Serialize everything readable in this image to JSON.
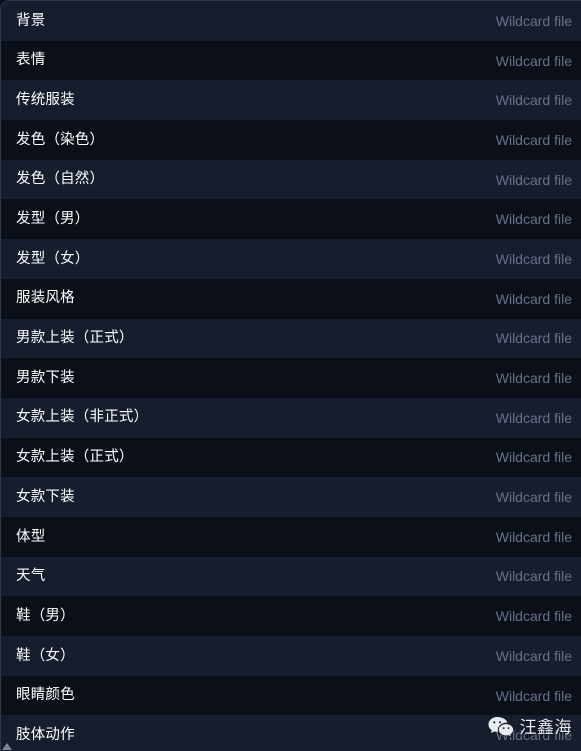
{
  "panel": {
    "accent_border": "#2b3850",
    "row_bg_odd": "#161d2c",
    "row_bg_even": "#0b1018",
    "label_color": "#ffffff",
    "type_color": "#67718a",
    "rows": [
      {
        "label": "背景",
        "type": "Wildcard file"
      },
      {
        "label": "表情",
        "type": "Wildcard file"
      },
      {
        "label": "传统服装",
        "type": "Wildcard file"
      },
      {
        "label": "发色（染色）",
        "type": "Wildcard file"
      },
      {
        "label": "发色（自然）",
        "type": "Wildcard file"
      },
      {
        "label": "发型（男）",
        "type": "Wildcard file"
      },
      {
        "label": "发型（女）",
        "type": "Wildcard file"
      },
      {
        "label": "服装风格",
        "type": "Wildcard file"
      },
      {
        "label": "男款上装（正式）",
        "type": "Wildcard file"
      },
      {
        "label": "男款下装",
        "type": "Wildcard file"
      },
      {
        "label": "女款上装（非正式）",
        "type": "Wildcard file"
      },
      {
        "label": "女款上装（正式）",
        "type": "Wildcard file"
      },
      {
        "label": "女款下装",
        "type": "Wildcard file"
      },
      {
        "label": "体型",
        "type": "Wildcard file"
      },
      {
        "label": "天气",
        "type": "Wildcard file"
      },
      {
        "label": "鞋（男）",
        "type": "Wildcard file"
      },
      {
        "label": "鞋（女）",
        "type": "Wildcard file"
      },
      {
        "label": "眼睛颜色",
        "type": "Wildcard file"
      },
      {
        "label": "肢体动作",
        "type": "Wildcard file"
      }
    ]
  },
  "watermark": {
    "icon": "wechat-icon",
    "name": "汪鑫海",
    "icon_color": "#e8ebf2"
  },
  "scroll_nub": {
    "icon": "scroll-up-arrow-icon"
  }
}
